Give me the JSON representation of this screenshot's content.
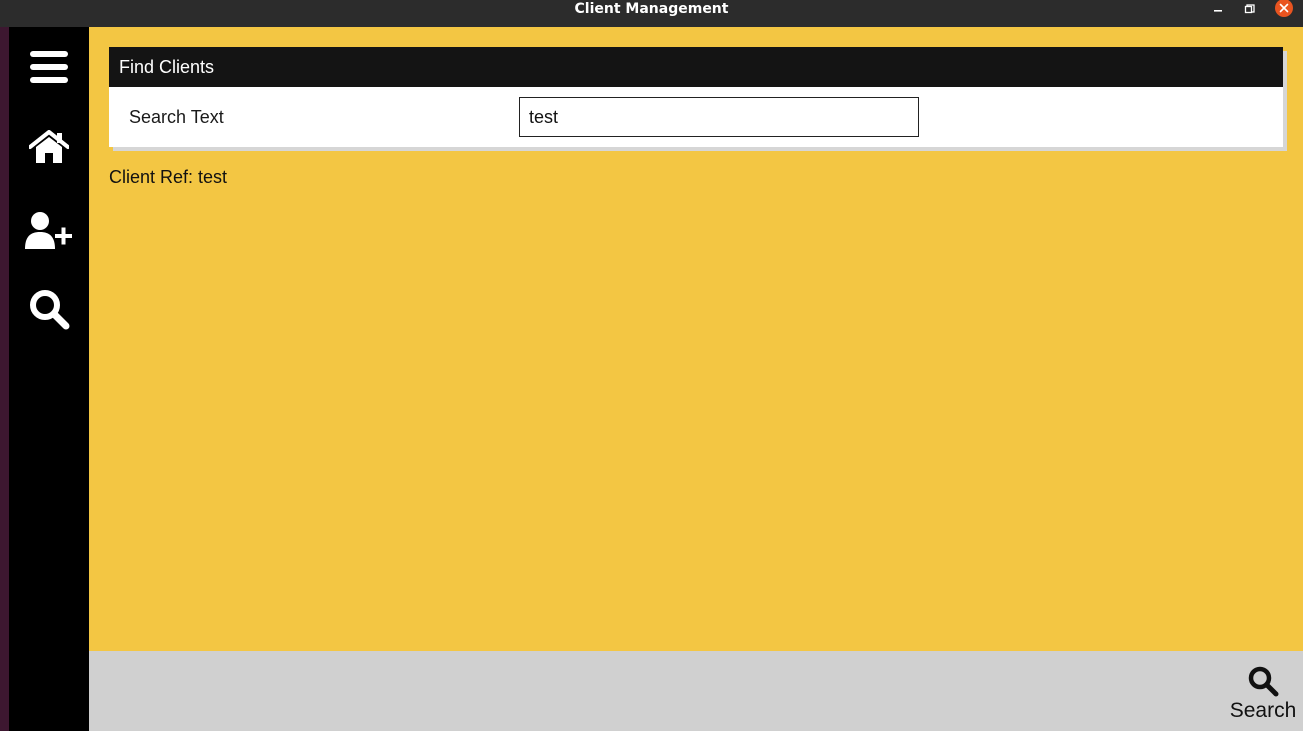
{
  "window": {
    "title": "Client Management"
  },
  "sidebar": {
    "items": [
      {
        "icon": "hamburger-menu-icon"
      },
      {
        "icon": "home-icon"
      },
      {
        "icon": "add-user-icon"
      },
      {
        "icon": "search-icon"
      }
    ]
  },
  "find_clients": {
    "header": "Find Clients",
    "search_label": "Search Text",
    "search_value": "test"
  },
  "results": {
    "client_ref": "Client Ref: test"
  },
  "bottombar": {
    "search_label": "Search"
  },
  "colors": {
    "main_background": "#f3c643",
    "sidebar_background": "#000000",
    "card_header": "#141414",
    "bottom_bar": "#d0d0d0",
    "close_button": "#e95420"
  }
}
